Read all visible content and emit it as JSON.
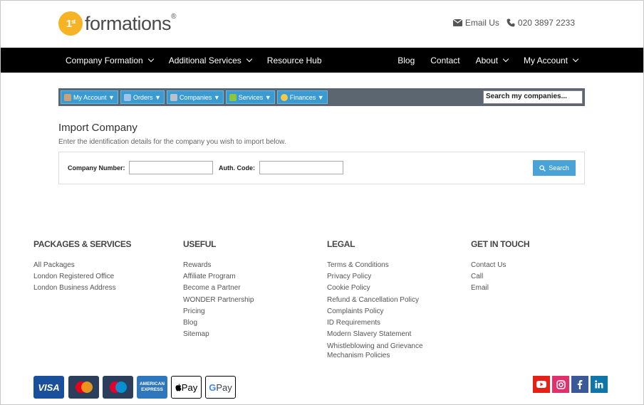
{
  "brand": {
    "logo_mark": "1st",
    "logo_text": "formations",
    "registered": "®"
  },
  "contact": {
    "email_label": "Email Us",
    "phone": "020 3897 2233"
  },
  "nav": {
    "left": [
      "Company Formation",
      "Additional Services",
      "Resource Hub"
    ],
    "right": [
      "Blog",
      "Contact",
      "About",
      "My Account"
    ]
  },
  "dashbar": {
    "items": [
      "My Account ▼",
      "Orders ▼",
      "Companies ▼",
      "Services ▼",
      "Finances ▼"
    ],
    "search_value": "Search my companies..."
  },
  "import": {
    "title": "Import Company",
    "description": "Enter the identification details for the company you wish to import below.",
    "company_number_label": "Company Number:",
    "auth_code_label": "Auth. Code:",
    "search_label": "Search"
  },
  "footer": {
    "packages": {
      "title": "PACKAGES & SERVICES",
      "links": [
        "All Packages",
        "London Registered Office",
        "London Business Address"
      ]
    },
    "useful": {
      "title": "USEFUL",
      "links": [
        "Rewards",
        "Affiliate Program",
        "Become a Partner",
        "WONDER Partnership",
        "Pricing",
        "Blog",
        "Sitemap"
      ]
    },
    "legal": {
      "title": "LEGAL",
      "links": [
        "Terms & Conditions",
        "Privacy Policy",
        "Cookie Policy",
        "Refund & Cancellation Policy",
        "Complaints Policy",
        "ID Requirements",
        "Modern Slavery Statement",
        "Whistleblowing and Grievance",
        "Mechanism Policies"
      ]
    },
    "contact": {
      "title": "GET IN TOUCH",
      "links": [
        "Contact Us",
        "Call",
        "Email"
      ]
    }
  },
  "payments": {
    "visa": "VISA",
    "amex_line1": "AMERICAN",
    "amex_line2": "EXPRESS",
    "apple": "Pay",
    "google": "Pay"
  },
  "colors": {
    "accent": "#f5b325",
    "nav_bg": "#000000",
    "button": "#4aa3d6",
    "youtube": "#e62117",
    "instagram": "#e1306c",
    "facebook": "#3b5998",
    "linkedin": "#0e76a8"
  }
}
